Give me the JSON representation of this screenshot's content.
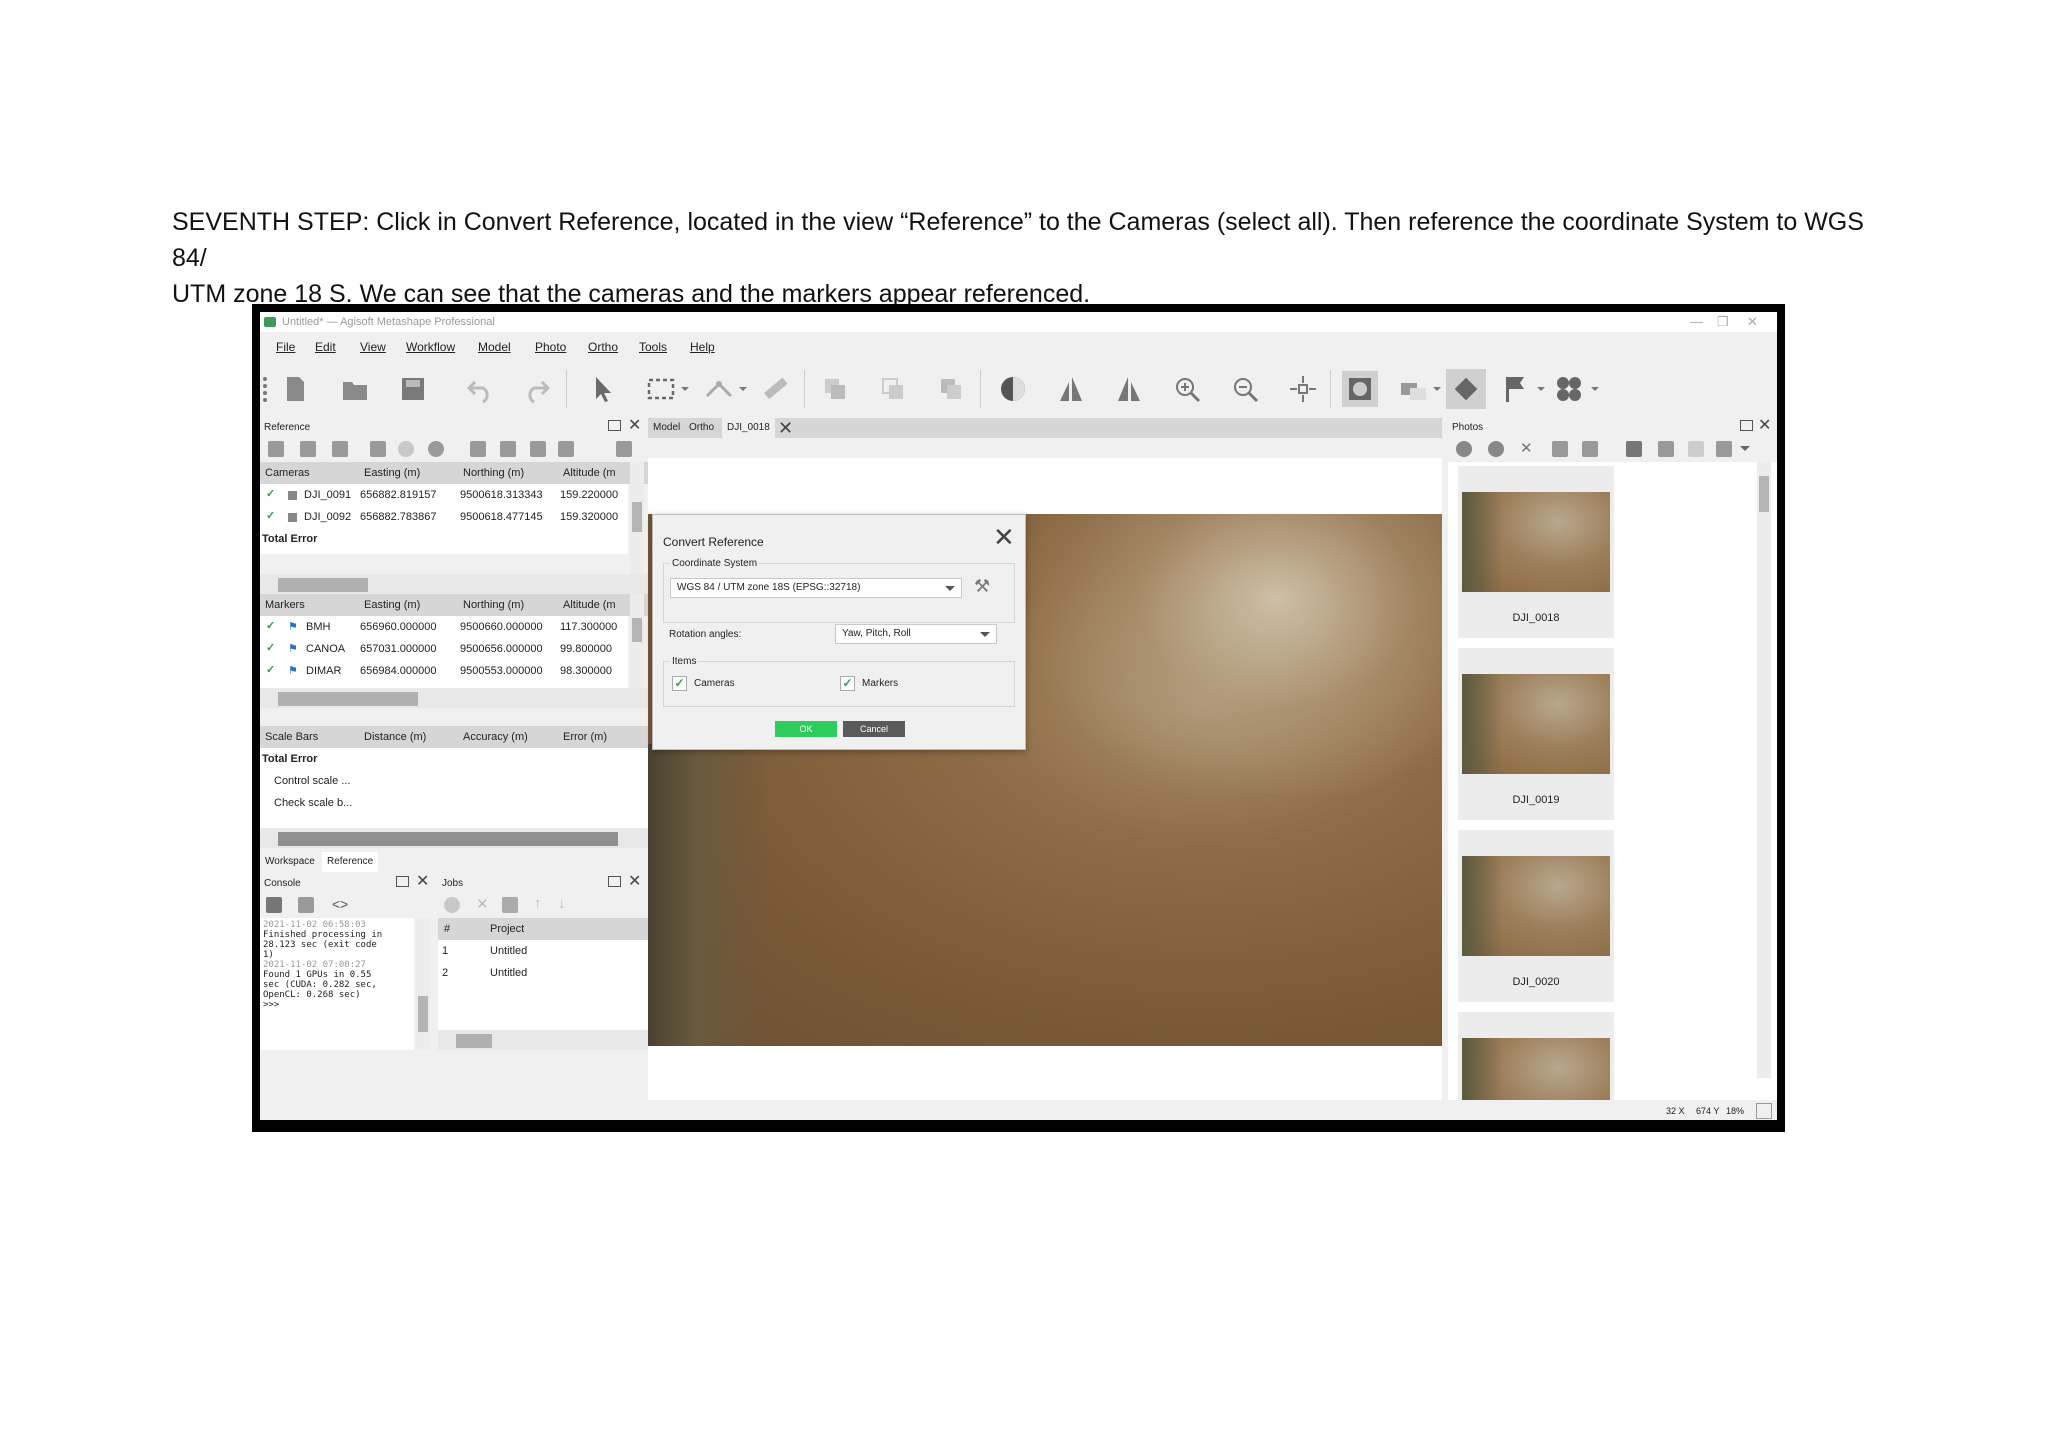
{
  "instruction": {
    "line1": "SEVENTH STEP: Click in Convert Reference, located in the view “Reference” to the Cameras (select all). Then reference the coordinate System to WGS 84/",
    "line2": "UTM zone 18 S.  We can see that the cameras and the markers appear referenced."
  },
  "window": {
    "title": "Untitled* — Agisoft Metashape Professional"
  },
  "menu": [
    "File",
    "Edit",
    "View",
    "Workflow",
    "Model",
    "Photo",
    "Ortho",
    "Tools",
    "Help"
  ],
  "reference_panel": {
    "title": "Reference",
    "cameras_header": [
      "Cameras",
      "Easting (m)",
      "Northing (m)",
      "Altitude (m"
    ],
    "cameras": [
      {
        "name": "DJI_0091",
        "easting": "656882.819157",
        "northing": "9500618.313343",
        "altitude": "159.220000"
      },
      {
        "name": "DJI_0092",
        "easting": "656882.783867",
        "northing": "9500618.477145",
        "altitude": "159.320000"
      }
    ],
    "total_error": "Total Error",
    "markers_header": [
      "Markers",
      "Easting (m)",
      "Northing (m)",
      "Altitude (m"
    ],
    "markers": [
      {
        "name": "BMH",
        "easting": "656960.000000",
        "northing": "9500660.000000",
        "altitude": "117.300000"
      },
      {
        "name": "CANOA",
        "easting": "657031.000000",
        "northing": "9500656.000000",
        "altitude": "99.800000"
      },
      {
        "name": "DIMAR",
        "easting": "656984.000000",
        "northing": "9500553.000000",
        "altitude": "98.300000"
      }
    ],
    "scalebars_header": [
      "Scale Bars",
      "Distance (m)",
      "Accuracy (m)",
      "Error (m)"
    ],
    "scalebars_total": "Total Error",
    "scalebars_items": [
      "Control scale ...",
      "Check scale b..."
    ],
    "tabs": [
      "Workspace",
      "Reference"
    ]
  },
  "console": {
    "title": "Console",
    "lines": [
      "2021-11-02 06:58:03",
      "Finished processing in",
      "28.123 sec (exit code",
      "1)",
      "2021-11-02 07:00:27",
      "Found 1 GPUs in 0.55",
      "sec (CUDA: 0.282 sec,",
      "OpenCL: 0.268 sec)",
      ">>>"
    ]
  },
  "jobs": {
    "title": "Jobs",
    "headers": [
      "#",
      "Project"
    ],
    "rows": [
      {
        "n": "1",
        "project": "Untitled"
      },
      {
        "n": "2",
        "project": "Untitled"
      }
    ]
  },
  "view_tabs": [
    "Model",
    "Ortho",
    "DJI_0018"
  ],
  "dialog": {
    "title": "Convert Reference",
    "coord_label": "Coordinate System",
    "coord_value": "WGS 84 / UTM zone 18S (EPSG::32718)",
    "rotation_label": "Rotation angles:",
    "rotation_value": "Yaw, Pitch, Roll",
    "items_label": "Items",
    "cameras_label": "Cameras",
    "markers_label": "Markers",
    "ok": "OK",
    "cancel": "Cancel",
    "ok_color": "#2ecc5a",
    "cancel_color": "#5a5a5a"
  },
  "photos_panel": {
    "title": "Photos",
    "items": [
      "DJI_0018",
      "DJI_0019",
      "DJI_0020"
    ]
  },
  "status": {
    "x": "32 X",
    "y": "674 Y",
    "zoom": "18%"
  }
}
